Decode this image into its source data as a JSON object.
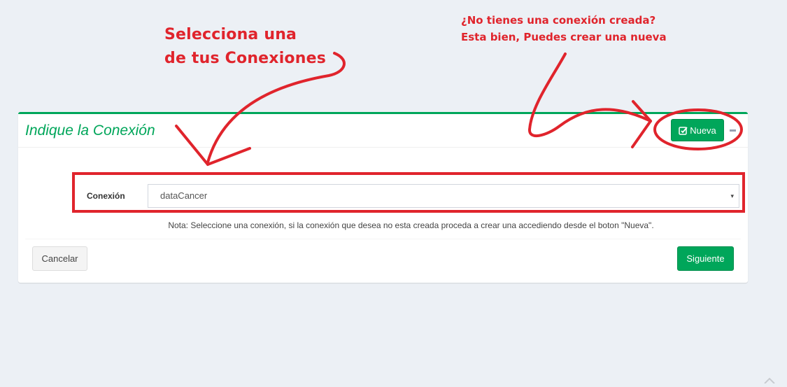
{
  "box": {
    "title": "Indique la Conexión",
    "new_button_label": "Nueva"
  },
  "form": {
    "label": "Conexión",
    "selected_value": "dataCancer",
    "arrow": "▾"
  },
  "note": "Nota: Seleccione una conexión, si la conexión que desea no esta creada proceda a crear una accediendo desde el boton \"Nueva\".",
  "footer": {
    "cancel_label": "Cancelar",
    "next_label": "Siguiente"
  },
  "annotations": {
    "left_line1": "Selecciona una",
    "left_line2": "de tus Conexiones",
    "right_line1": "¿No tienes una conexión creada?",
    "right_line2": "Esta bien, Puedes crear una nueva"
  },
  "colors": {
    "accent": "#00a65a",
    "annotation": "#e0242c",
    "background": "#ecf0f5"
  },
  "icons": {
    "new": "edit-check-icon",
    "collapse": "minus-icon",
    "dropdown": "caret-down-icon",
    "scroll": "chevron-up-icon"
  }
}
